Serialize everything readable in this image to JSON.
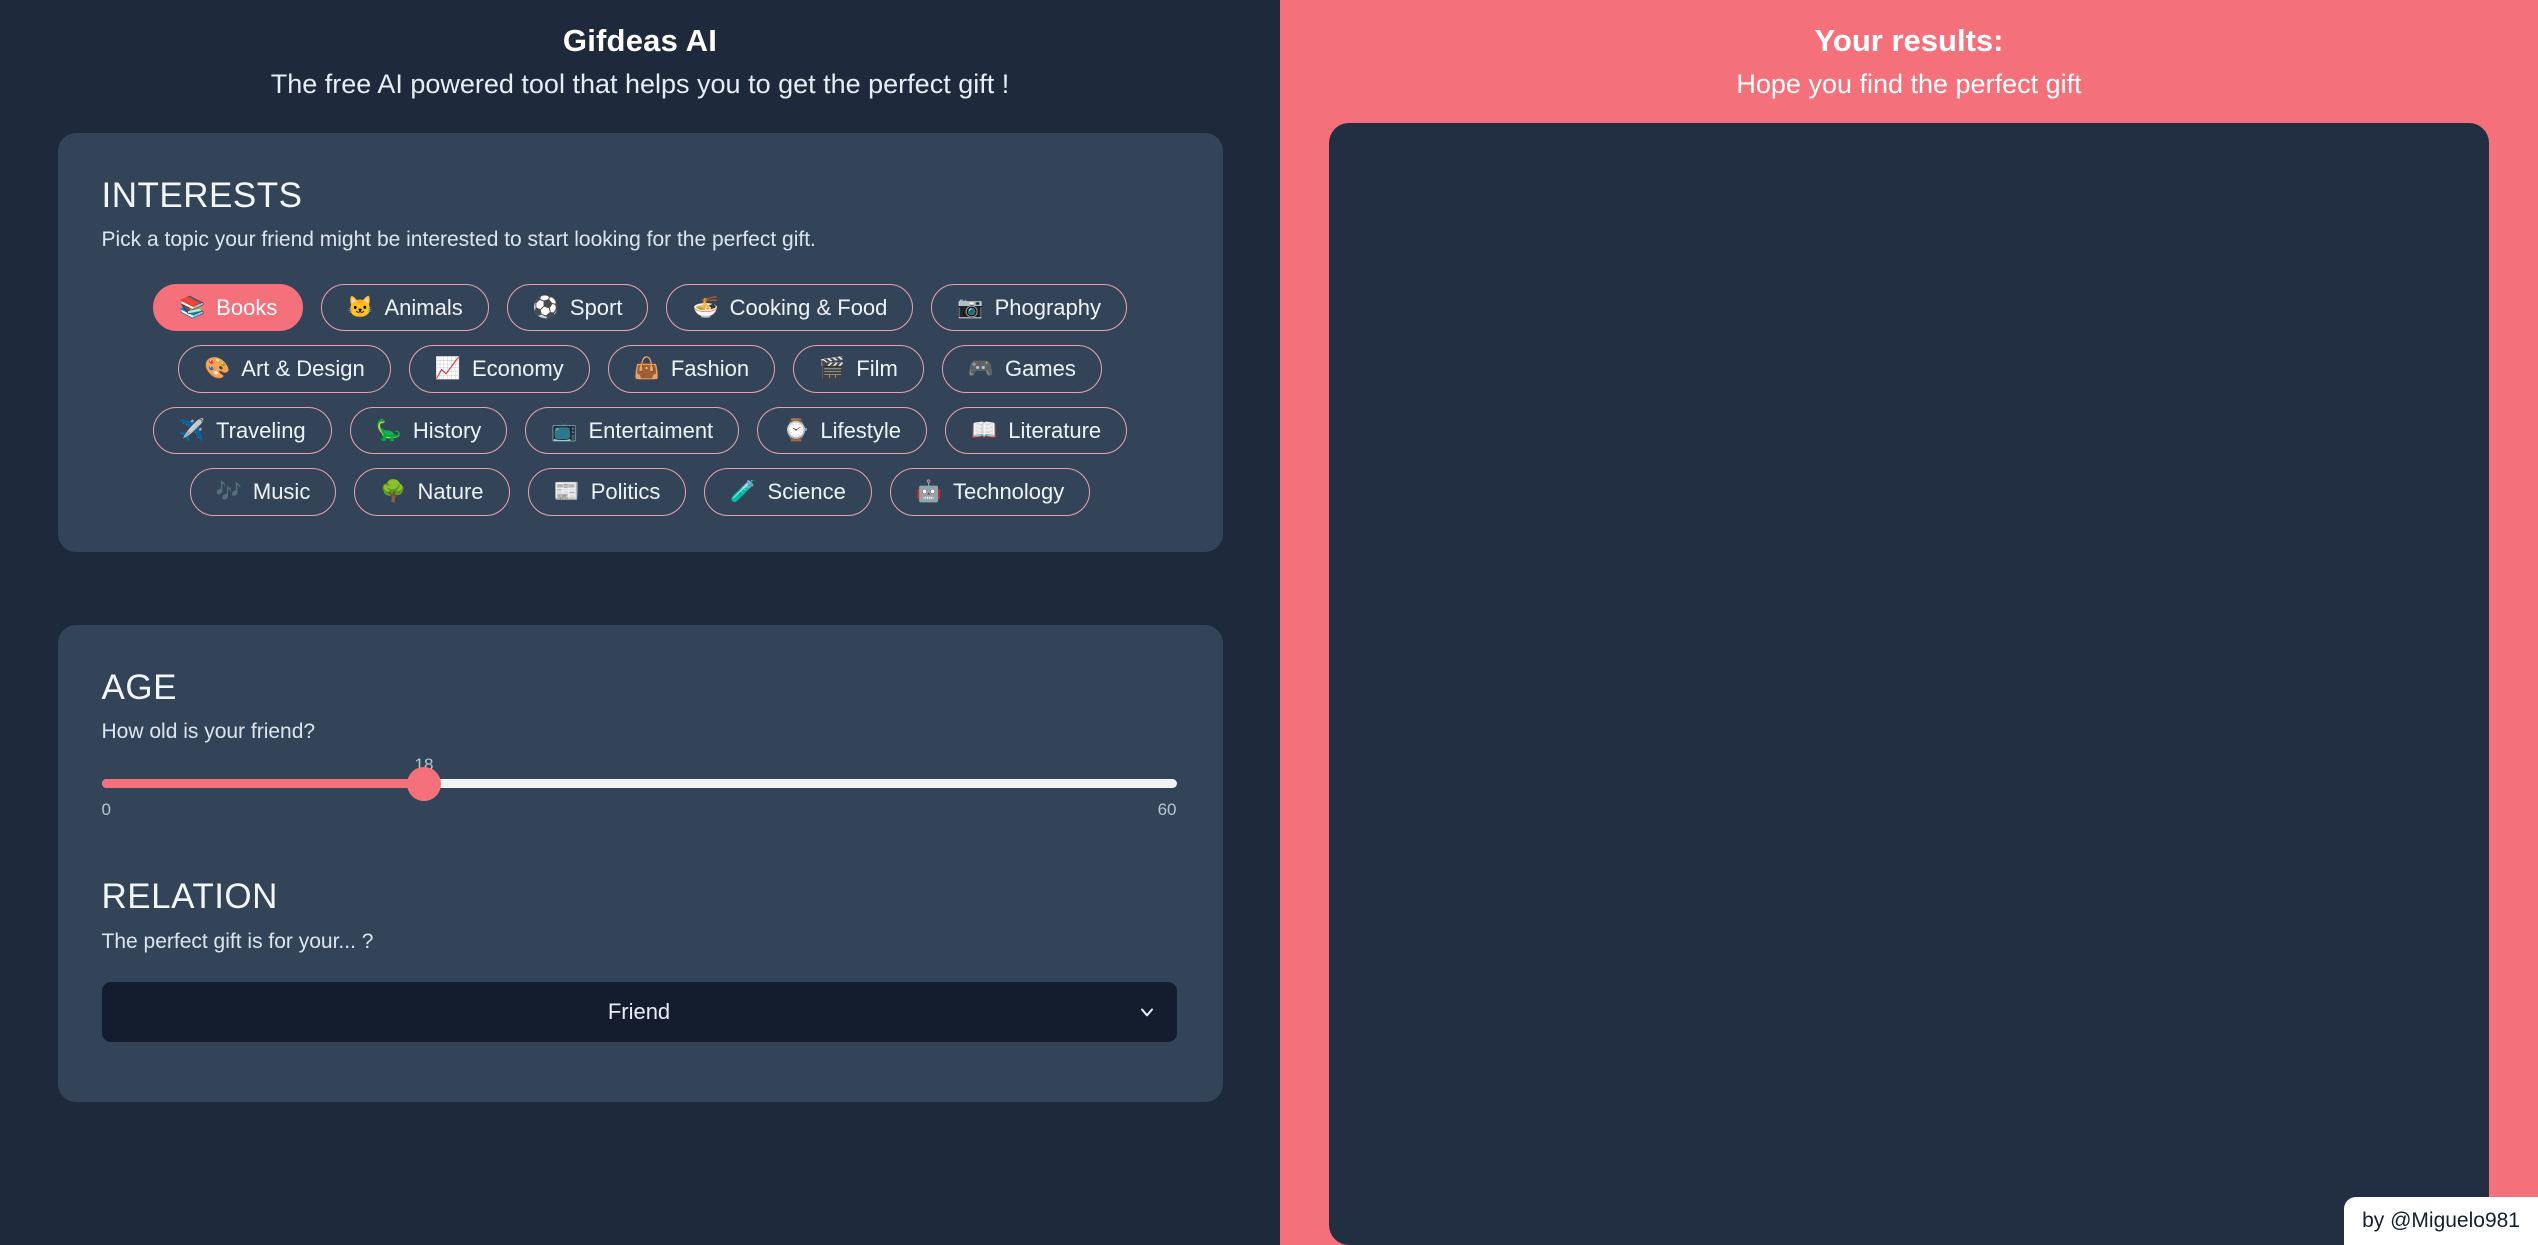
{
  "app": {
    "title": "Gifdeas AI",
    "subtitle": "The free AI powered tool that helps you to get the perfect gift !"
  },
  "interests": {
    "heading": "INTERESTS",
    "description": "Pick a topic your friend might be interested to start looking for the perfect gift.",
    "selected": "Books",
    "chips": [
      {
        "label": "Books",
        "emoji": "📚",
        "icon": "books-icon",
        "selected": true
      },
      {
        "label": "Animals",
        "emoji": "🐱",
        "icon": "cat-face-icon",
        "selected": false
      },
      {
        "label": "Sport",
        "emoji": "⚽",
        "icon": "soccer-ball-icon",
        "selected": false
      },
      {
        "label": "Cooking & Food",
        "emoji": "🍜",
        "icon": "ramen-bowl-icon",
        "selected": false
      },
      {
        "label": "Phography",
        "emoji": "📷",
        "icon": "camera-icon",
        "selected": false
      },
      {
        "label": "Art & Design",
        "emoji": "🎨",
        "icon": "palette-icon",
        "selected": false
      },
      {
        "label": "Economy",
        "emoji": "📈",
        "icon": "chart-up-icon",
        "selected": false
      },
      {
        "label": "Fashion",
        "emoji": "👜",
        "icon": "handbag-icon",
        "selected": false
      },
      {
        "label": "Film",
        "emoji": "🎬",
        "icon": "clapperboard-icon",
        "selected": false
      },
      {
        "label": "Games",
        "emoji": "🎮",
        "icon": "gamepad-icon",
        "selected": false
      },
      {
        "label": "Traveling",
        "emoji": "✈️",
        "icon": "airplane-icon",
        "selected": false
      },
      {
        "label": "History",
        "emoji": "🦕",
        "icon": "sauropod-icon",
        "selected": false
      },
      {
        "label": "Entertaiment",
        "emoji": "📺",
        "icon": "television-icon",
        "selected": false
      },
      {
        "label": "Lifestyle",
        "emoji": "⌚",
        "icon": "watch-icon",
        "selected": false
      },
      {
        "label": "Literature",
        "emoji": "📖",
        "icon": "open-book-icon",
        "selected": false
      },
      {
        "label": "Music",
        "emoji": "🎶",
        "icon": "music-notes-icon",
        "selected": false
      },
      {
        "label": "Nature",
        "emoji": "🌳",
        "icon": "tree-icon",
        "selected": false
      },
      {
        "label": "Politics",
        "emoji": "📰",
        "icon": "newspaper-icon",
        "selected": false
      },
      {
        "label": "Science",
        "emoji": "🧪",
        "icon": "test-tube-icon",
        "selected": false
      },
      {
        "label": "Technology",
        "emoji": "🤖",
        "icon": "robot-icon",
        "selected": false
      }
    ]
  },
  "age": {
    "heading": "AGE",
    "description": "How old is your friend?",
    "value": "18",
    "min": "0",
    "max": "60",
    "percent": 30
  },
  "relation": {
    "heading": "RELATION",
    "description": "The perfect gift is for your... ?",
    "value": "Friend",
    "caret_icon": "chevron-down-icon"
  },
  "results": {
    "title": "Your results:",
    "subtitle": "Hope you find the perfect gift"
  },
  "credit": {
    "text": "by @Miguelo981"
  },
  "colors": {
    "accent": "#f4707a",
    "page_bg": "#1e293b",
    "card_bg": "#334459",
    "results_box_bg": "#222e42",
    "select_bg": "#141d2e",
    "chip_border": "#e9a3ae"
  }
}
